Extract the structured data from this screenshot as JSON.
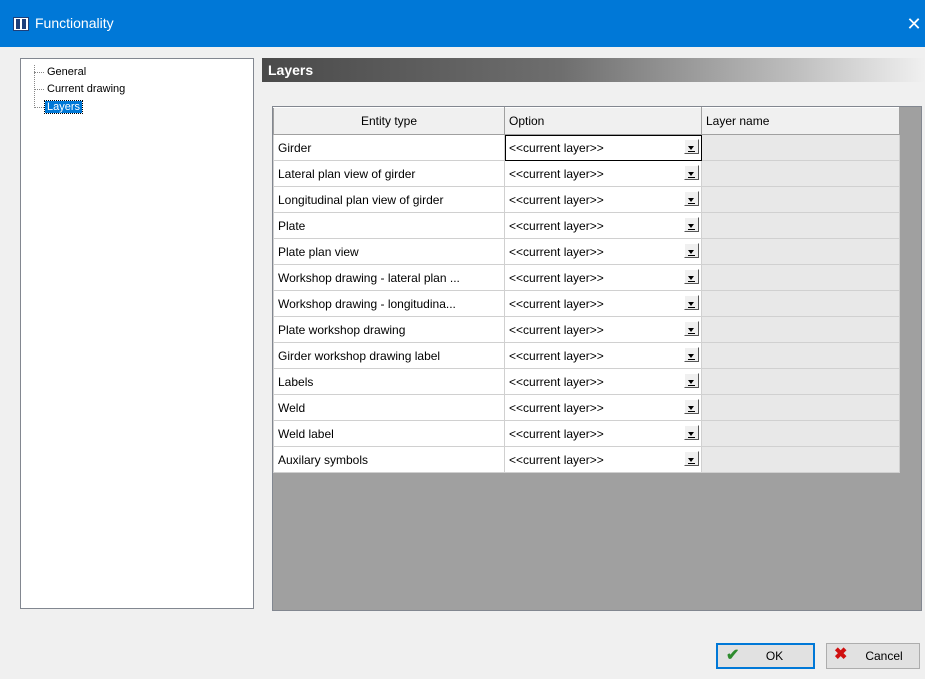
{
  "window": {
    "title": "Functionality",
    "close_glyph": "✕"
  },
  "tree": {
    "items": [
      {
        "label": "General"
      },
      {
        "label": "Current drawing"
      },
      {
        "label": "Layers",
        "selected": true
      }
    ]
  },
  "section": {
    "title": "Layers"
  },
  "grid": {
    "columns": [
      "Entity type",
      "Option",
      "Layer name"
    ],
    "rows": [
      {
        "entity": "Girder",
        "option": "<<current layer>>",
        "layer": ""
      },
      {
        "entity": "Lateral plan view of girder",
        "option": "<<current layer>>",
        "layer": ""
      },
      {
        "entity": "Longitudinal plan view of girder",
        "option": "<<current layer>>",
        "layer": ""
      },
      {
        "entity": "Plate",
        "option": "<<current layer>>",
        "layer": ""
      },
      {
        "entity": "Plate plan view",
        "option": "<<current layer>>",
        "layer": ""
      },
      {
        "entity": "Workshop drawing - lateral plan ...",
        "option": "<<current layer>>",
        "layer": ""
      },
      {
        "entity": "Workshop drawing - longitudina...",
        "option": "<<current layer>>",
        "layer": ""
      },
      {
        "entity": "Plate workshop drawing",
        "option": "<<current layer>>",
        "layer": ""
      },
      {
        "entity": "Girder workshop drawing label",
        "option": "<<current layer>>",
        "layer": ""
      },
      {
        "entity": "Labels",
        "option": "<<current layer>>",
        "layer": ""
      },
      {
        "entity": "Weld",
        "option": "<<current layer>>",
        "layer": ""
      },
      {
        "entity": "Weld label",
        "option": "<<current layer>>",
        "layer": ""
      },
      {
        "entity": "Auxilary symbols",
        "option": "<<current layer>>",
        "layer": ""
      }
    ]
  },
  "buttons": {
    "ok": "OK",
    "cancel": "Cancel"
  },
  "colors": {
    "titlebar": "#0078d7",
    "selection": "#0078d7",
    "ok_icon": "#2e8b2e",
    "cancel_icon": "#d01010"
  }
}
